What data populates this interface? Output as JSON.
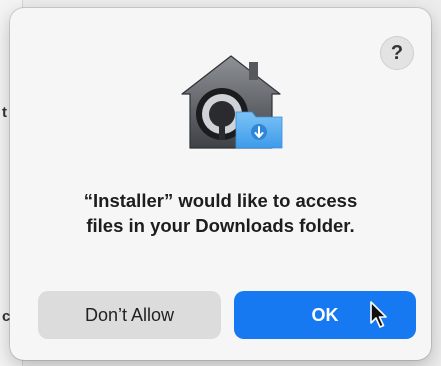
{
  "dialog": {
    "help_label": "?",
    "message_line1": "“Installer” would like to access",
    "message_line2": "files in your Downloads folder.",
    "deny_label": "Don’t Allow",
    "allow_label": "OK",
    "app_icon": "privacy-lock-with-downloads-folder-icon"
  },
  "colors": {
    "primary_button": "#1679f2",
    "secondary_button": "#dcdcdc",
    "dialog_background": "#f6f6f6"
  }
}
